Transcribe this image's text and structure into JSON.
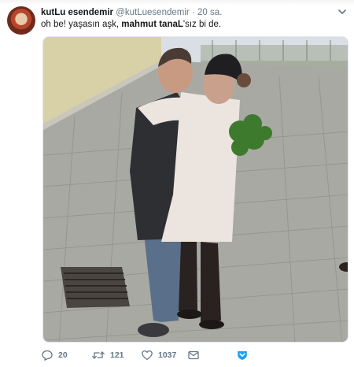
{
  "tweet": {
    "display_name": "kutLu esendemir",
    "handle": "@kutLuesendemir",
    "separator": "·",
    "time": "20 sa.",
    "text_prefix": "oh be! yaşasın aşk, ",
    "text_mention": "mahmut tanaL",
    "text_suffix": "'sız bi de."
  },
  "actions": {
    "reply_count": "20",
    "retweet_count": "121",
    "like_count": "1037"
  },
  "icons": [
    "avatar",
    "chevron-down-icon",
    "reply-icon",
    "retweet-icon",
    "like-icon",
    "message-icon",
    "twitter-logo-icon"
  ],
  "colors": {
    "text": "#14171a",
    "muted": "#657786",
    "brand": "#1da1f2"
  }
}
